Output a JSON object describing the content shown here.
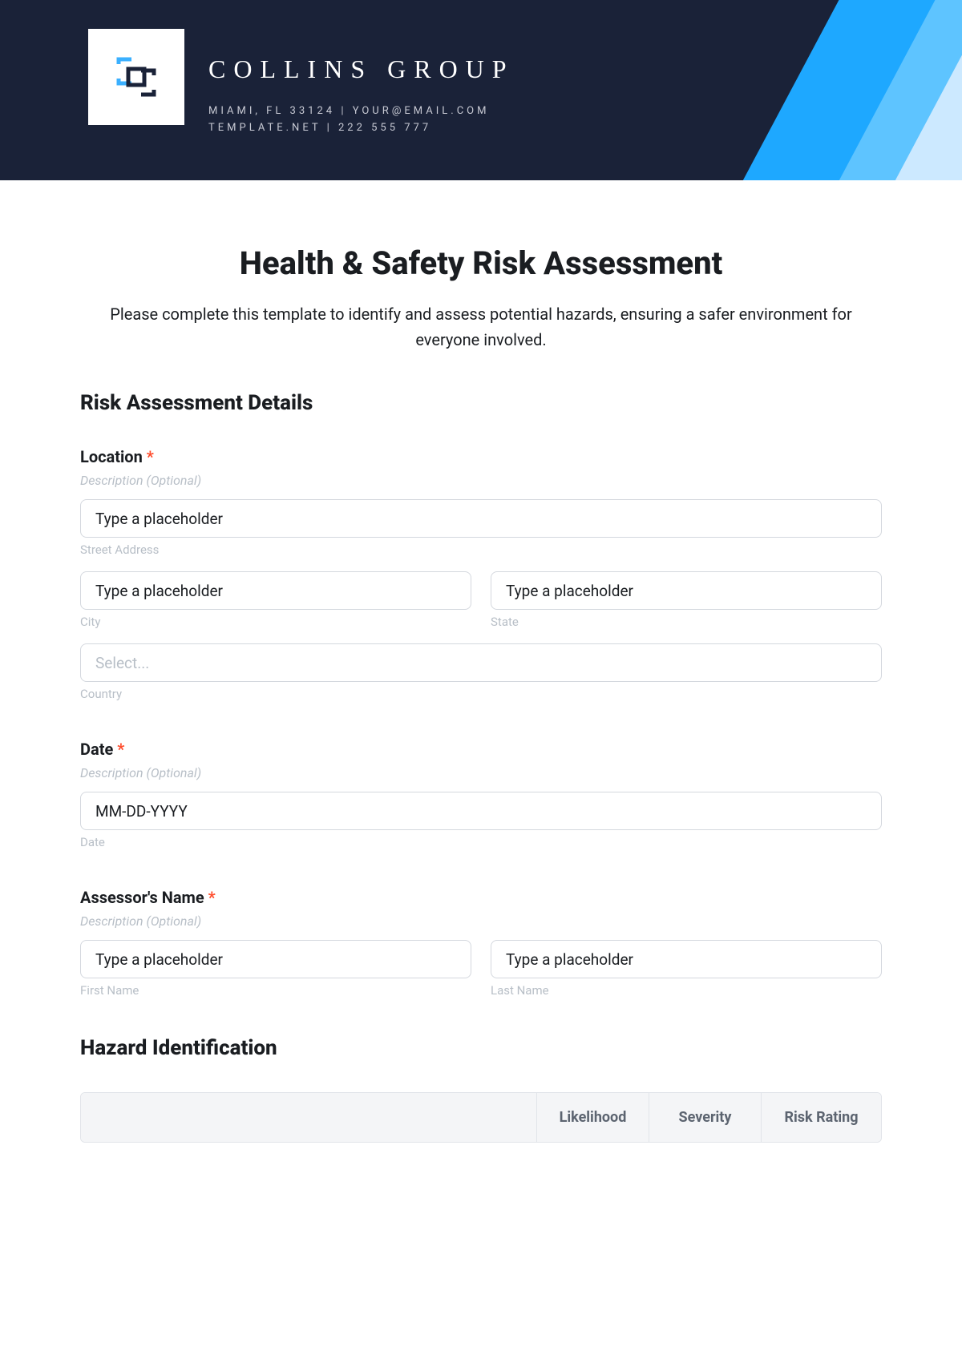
{
  "header": {
    "company_name": "COLLINS GROUP",
    "contact_line1": "MIAMI, FL 33124 | YOUR@EMAIL.COM",
    "contact_line2": "TEMPLATE.NET | 222 555 777"
  },
  "page": {
    "title": "Health & Safety Risk Assessment",
    "intro": "Please complete this template to identify and assess potential hazards, ensuring a safer environment for everyone involved."
  },
  "section1": {
    "title": "Risk Assessment Details"
  },
  "location": {
    "label": "Location",
    "desc": "Description (Optional)",
    "street_placeholder": "Type a placeholder",
    "street_sub": "Street Address",
    "city_placeholder": "Type a placeholder",
    "city_sub": "City",
    "state_placeholder": "Type a placeholder",
    "state_sub": "State",
    "country_placeholder": "Select...",
    "country_sub": "Country"
  },
  "date": {
    "label": "Date",
    "desc": "Description (Optional)",
    "placeholder": "MM-DD-YYYY",
    "sub": "Date"
  },
  "assessor": {
    "label": "Assessor's Name",
    "desc": "Description (Optional)",
    "first_placeholder": "Type a placeholder",
    "first_sub": "First Name",
    "last_placeholder": "Type a placeholder",
    "last_sub": "Last Name"
  },
  "section2": {
    "title": "Hazard Identification"
  },
  "hazard_table": {
    "col1": "Likelihood",
    "col2": "Severity",
    "col3": "Risk Rating"
  },
  "required_marker": "*"
}
